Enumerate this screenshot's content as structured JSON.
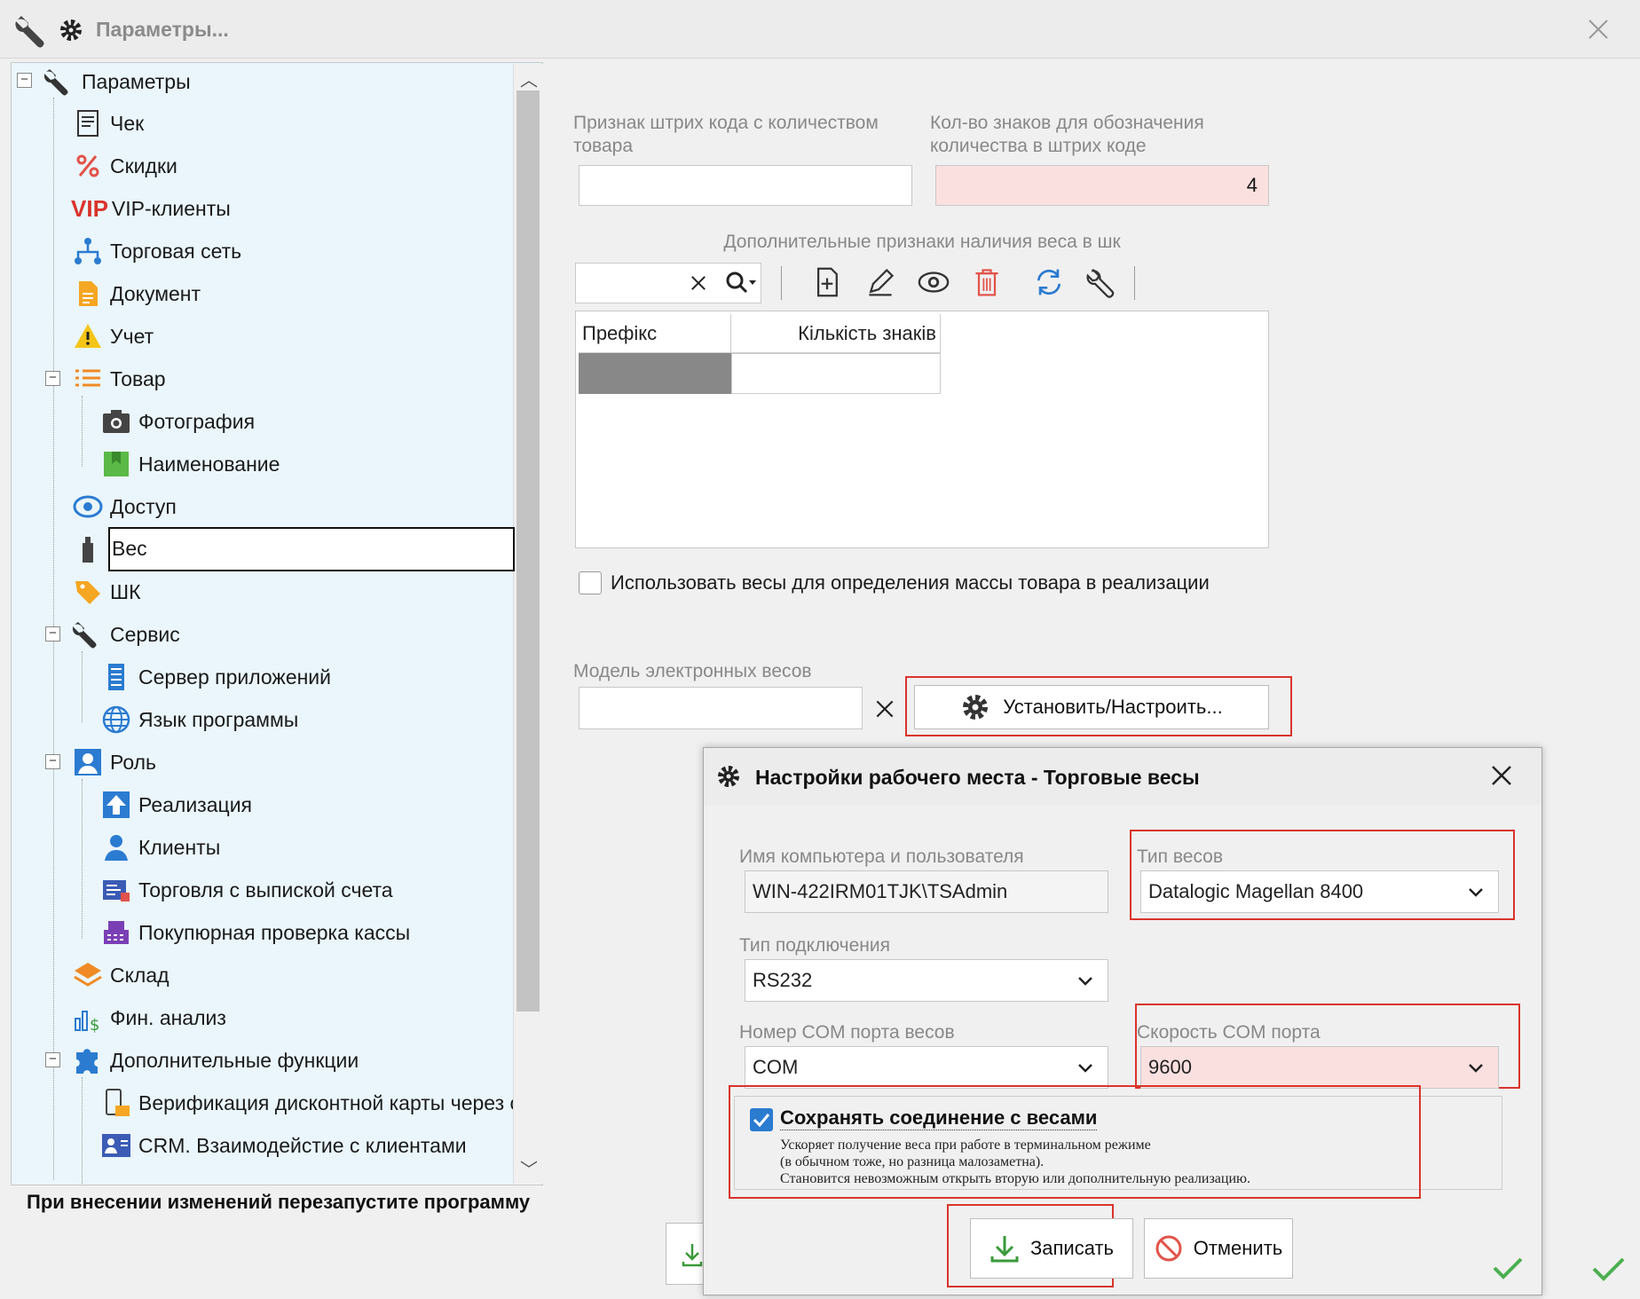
{
  "window": {
    "title": "Параметры..."
  },
  "tree": {
    "items": [
      {
        "label": "Параметры"
      },
      {
        "label": "Чек"
      },
      {
        "label": "Скидки"
      },
      {
        "label": "VIP-клиенты"
      },
      {
        "label": "Торговая сеть"
      },
      {
        "label": "Документ"
      },
      {
        "label": "Учет"
      },
      {
        "label": "Товар"
      },
      {
        "label": "Фотография"
      },
      {
        "label": "Наименование"
      },
      {
        "label": "Доступ"
      },
      {
        "label": "Вес"
      },
      {
        "label": "ШК"
      },
      {
        "label": "Сервис"
      },
      {
        "label": "Сервер приложений"
      },
      {
        "label": "Язык программы"
      },
      {
        "label": "Роль"
      },
      {
        "label": "Реализация"
      },
      {
        "label": "Клиенты"
      },
      {
        "label": "Торговля с выпиской счета"
      },
      {
        "label": "Покупюрная проверка кассы"
      },
      {
        "label": "Склад"
      },
      {
        "label": "Фин. анализ"
      },
      {
        "label": "Дополнительные функции"
      },
      {
        "label": "Верификация дисконтной карты через сі"
      },
      {
        "label": "CRM. Взаимодейстие с клиентами"
      }
    ],
    "vip_text": "VIP"
  },
  "footer_note": "При внесении изменений перезапустите программу",
  "main": {
    "barcode_qty_label": "Признак штрих кода с количеством товара",
    "barcode_qty_value": "",
    "digits_label": "Кол-во знаков для обозначения количества в штрих коде",
    "digits_value": "4",
    "extra_weight_label": "Дополнительные признаки наличия веса в шк",
    "grid_columns": [
      "Префікс",
      "Кількість знаків"
    ],
    "use_scales_label": "Использовать весы для определения массы товара в реализации",
    "use_scales_checked": false,
    "scale_model_label": "Модель электронных весов",
    "scale_model_value": "",
    "setup_button": "Установить/Настроить..."
  },
  "dialog": {
    "title": "Настройки рабочего места - Торговые весы",
    "computer_label": "Имя компьютера и пользователя",
    "computer_value": "WIN-422IRM01TJK\\TSAdmin",
    "scale_type_label": "Тип весов",
    "scale_type_value": "Datalogic Magellan 8400",
    "connection_label": "Тип подключения",
    "connection_value": "RS232",
    "com_port_label": "Номер COM порта весов",
    "com_port_value": "COM",
    "com_speed_label": "Скорость COM порта",
    "com_speed_value": "9600",
    "keep_connection_label": "Сохранять соединение с весами",
    "keep_connection_checked": true,
    "keep_connection_desc": [
      "Ускоряет получение веса при работе в терминальном режиме",
      "(в обычном тоже, но разница малозаметна).",
      "Становится невозможным открыть вторую или дополнительную реализацию."
    ],
    "save_button": "Записать",
    "cancel_button": "Отменить"
  },
  "colors": {
    "accent_red": "#d9342b",
    "highlight_pink": "#fbe0e0",
    "tree_bg": "#eaf6fb",
    "check_green": "#4caf50"
  }
}
